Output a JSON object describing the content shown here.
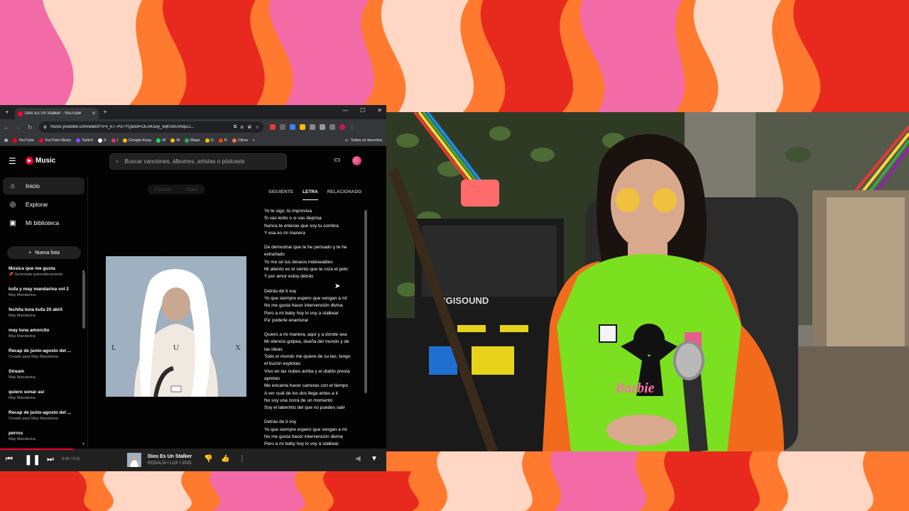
{
  "browser": {
    "tab_title": "Dios Es Un Stalker - YouTube",
    "url": "music.youtube.com/watch?v=t_k7--Po7YQ&list=OLAK5uy_kqKS5UvhqIZJ...",
    "bookmarks": [
      {
        "label": "YouTube",
        "color": "#ff0000"
      },
      {
        "label": "YouTube Music",
        "color": "#ff0033"
      },
      {
        "label": "Twitch",
        "color": "#9146ff"
      },
      {
        "label": "X",
        "color": "#ffffff"
      },
      {
        "label": "I",
        "color": "#e1306c"
      },
      {
        "label": "Google Keep",
        "color": "#fbbc04"
      },
      {
        "label": "W",
        "color": "#25d366"
      },
      {
        "label": "M",
        "color": "#fbbc04"
      },
      {
        "label": "Maps",
        "color": "#34a853"
      },
      {
        "label": "G",
        "color": "#fbbc04"
      },
      {
        "label": "R",
        "color": "#ff4500"
      },
      {
        "label": "Clima",
        "color": "#ff7043"
      }
    ],
    "favorites_label": "Todos os favoritos"
  },
  "ytm": {
    "logo": "Music",
    "search_placeholder": "Buscar canciones, álbumes, artistas o pódcasts",
    "nav": [
      {
        "label": "Inicio",
        "icon": "home-icon"
      },
      {
        "label": "Explorar",
        "icon": "explore-icon"
      },
      {
        "label": "Mi biblioteca",
        "icon": "library-icon"
      }
    ],
    "new_list_label": "Nueva lista",
    "playlists": [
      {
        "title": "Música que me gusta",
        "sub": "Generada automáticamente"
      },
      {
        "title": "kufa y may mandarina vol 2",
        "sub": "May Mandarina"
      },
      {
        "title": "fechita luna kufa 20 abril",
        "sub": "May Mandarina"
      },
      {
        "title": "may luna amorcito",
        "sub": "May Mandarina"
      },
      {
        "title": "Recap de junio-agosto del ...",
        "sub": "Creado para May Mandarina"
      },
      {
        "title": "Stream",
        "sub": "May Mandarina"
      },
      {
        "title": "quiero sonar asi",
        "sub": "May Mandarina"
      },
      {
        "title": "Recap de junio-agosto del ...",
        "sub": "Creado para May Mandarina"
      },
      {
        "title": "perros",
        "sub": "May Mandarina"
      }
    ],
    "toggle": {
      "song": "Canción",
      "video": "Video"
    },
    "album_letters": [
      "L",
      "U",
      "X"
    ],
    "tabs": [
      "SIGUIENTE",
      "LETRA",
      "RELACIONADO"
    ],
    "lyrics": [
      [
        "Yo te sigo, tú improvisa",
        "Si vas lento o si vas deprisa",
        "Nunca te enteras que soy tu sombra",
        "Y esa es mi manera"
      ],
      [
        "De demostrar que te he pensado y te he",
        "extrañado",
        "Yo me sé tus deseos indeseables",
        "Mi aliento es el viento que te roza el pelo",
        "Y por amor estoy detrás"
      ],
      [
        "Detrás de ti voy",
        "Yo que siempre espero que vengan a mí",
        "No me gusta hacer intervención divina",
        "Pero a mi baby hoy lo voy a stalkear",
        "Pa' poderle enamorar"
      ],
      [
        "Quiero a mi manera, aquí y a donde sea",
        "Mi silencio golpea, dueña del mundo y de",
        "las ideas",
        "Todo el mundo me quiere de su lao, tengo",
        "el buzón explotao",
        "Vivo en las nubes arriba y el diablo presta",
        "apretao",
        "Me encanta hacer carreras con el tiempo",
        "A ver cuál de los dos llega antes a ti",
        "No soy una zorra de un momento",
        "Soy el laberinto del que no puedes salir"
      ],
      [
        "Detrás de ti voy",
        "Yo que siempre espero que vengan a mí",
        "No me gusta hacer intervención divina",
        "Pero a mi baby hoy lo voy a stalkear",
        "Pa' poderle enamorar"
      ]
    ],
    "player": {
      "time": "0:25 / 2:11",
      "title": "Dios Es Un Stalker",
      "subtitle": "ROSALÍA • LUX • 2025",
      "progress": 0.19
    }
  },
  "colors": {
    "accent": "#ff0033",
    "bg_orange": "#ff6a2a",
    "bg_pink": "#f06aa8",
    "bg_red": "#e8231c"
  }
}
